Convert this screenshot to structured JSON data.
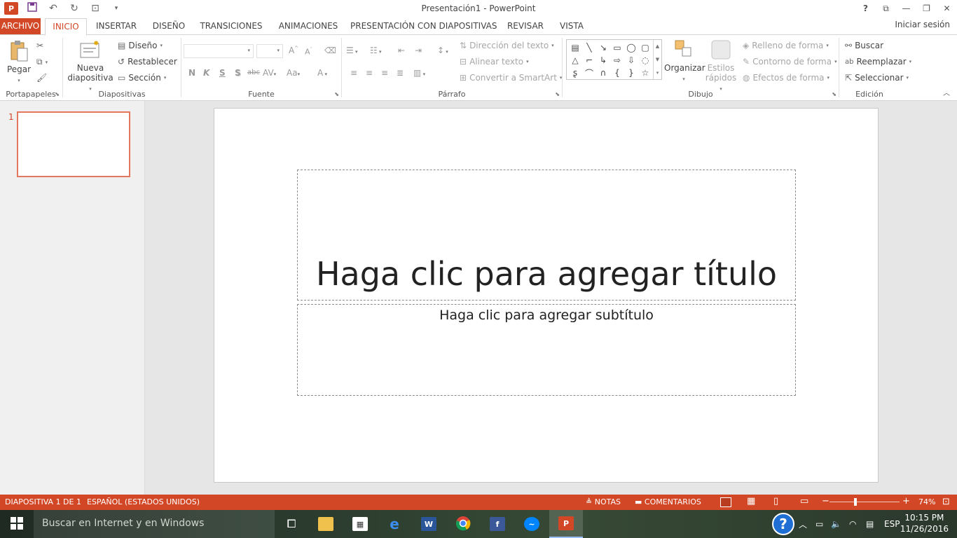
{
  "window": {
    "title": "Presentación1 - PowerPoint",
    "logo_text": "P"
  },
  "tabs": [
    {
      "label": "ARCHIVO"
    },
    {
      "label": "INICIO"
    },
    {
      "label": "INSERTAR"
    },
    {
      "label": "DISEÑO"
    },
    {
      "label": "TRANSICIONES"
    },
    {
      "label": "ANIMACIONES"
    },
    {
      "label": "PRESENTACIÓN CON DIAPOSITIVAS"
    },
    {
      "label": "REVISAR"
    },
    {
      "label": "VISTA"
    }
  ],
  "account": {
    "signin": "Iniciar sesión"
  },
  "ribbon": {
    "portapapeles": {
      "label": "Portapapeles",
      "paste": "Pegar"
    },
    "diapositivas": {
      "label": "Diapositivas",
      "new_slide_1": "Nueva",
      "new_slide_2": "diapositiva",
      "layout": "Diseño",
      "reset": "Restablecer",
      "section": "Sección"
    },
    "fuente": {
      "label": "Fuente",
      "bold": "N",
      "italic": "K",
      "underline": "S",
      "shadow": "S",
      "strike": "abc",
      "spacing": "AV",
      "case": "Aa",
      "color": "A"
    },
    "parrafo": {
      "label": "Párrafo",
      "text_direction": "Dirección del texto",
      "align_text": "Alinear texto",
      "smartart": "Convertir a SmartArt"
    },
    "dibujo": {
      "label": "Dibujo",
      "arrange": "Organizar",
      "quick_styles_1": "Estilos",
      "quick_styles_2": "rápidos",
      "fill": "Relleno de forma",
      "outline": "Contorno de forma",
      "effects": "Efectos de forma"
    },
    "edicion": {
      "label": "Edición",
      "find": "Buscar",
      "replace": "Reemplazar",
      "select": "Seleccionar"
    }
  },
  "slides": [
    {
      "number": "1"
    }
  ],
  "slide": {
    "title_placeholder": "Haga clic para agregar título",
    "subtitle_placeholder": "Haga clic para agregar subtítulo"
  },
  "status": {
    "slide_count": "DIAPOSITIVA 1 DE 1",
    "language": "ESPAÑOL (ESTADOS UNIDOS)",
    "notes": "NOTAS",
    "comments": "COMENTARIOS",
    "zoom": "74%",
    "zoom_level": 0.74
  },
  "taskbar": {
    "search_placeholder": "Buscar en Internet y en Windows",
    "language": "ESP",
    "time": "10:15 PM",
    "date": "11/26/2016"
  },
  "colors": {
    "accent": "#d24726",
    "taskbar": "#2c3d2f"
  }
}
